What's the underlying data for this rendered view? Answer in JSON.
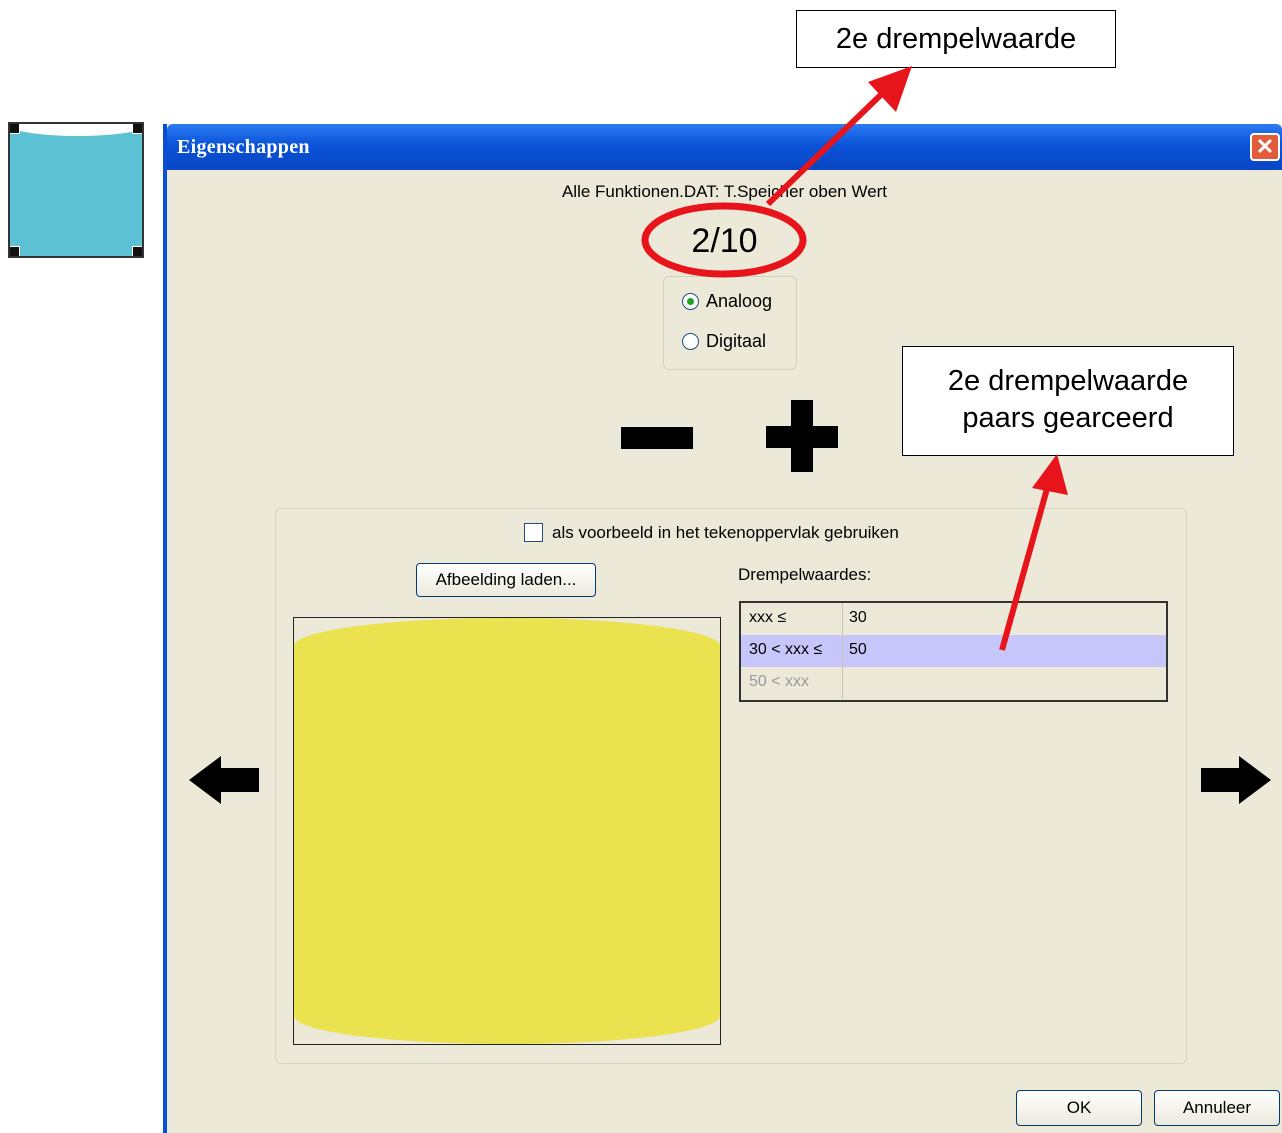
{
  "dialog": {
    "title": "Eigenschappen",
    "close_symbol": "✕",
    "subtitle": "Alle Funktionen.DAT: T.Speicher oben Wert",
    "counter": "2/10",
    "radio": {
      "analog_label": "Analoog",
      "digital_label": "Digitaal",
      "selected": "Analoog"
    },
    "checkbox_label": "als voorbeeld in het tekenoppervlak gebruiken",
    "checkbox_checked": false,
    "load_button": "Afbeelding laden...",
    "thresholds_label": "Drempelwaardes:",
    "thresholds": [
      {
        "condition": "xxx ≤",
        "value": "30"
      },
      {
        "condition": "30 < xxx ≤",
        "value": "50"
      },
      {
        "condition": "50 < xxx",
        "value": ""
      }
    ],
    "selected_threshold_row": 1,
    "ok_button": "OK",
    "cancel_button": "Annuleer",
    "preview_color": "#ebe24f",
    "thumbnail_color": "#5cc1d3",
    "highlight_color": "#c7c6fa"
  },
  "annotations": {
    "callout_top": "2e drempelwaarde",
    "callout_right_line1": "2e drempelwaarde",
    "callout_right_line2": "paars gearceerd",
    "annotation_color": "#e8141b"
  },
  "icons": [
    "close-icon",
    "minus-icon",
    "plus-icon",
    "arrow-left-icon",
    "arrow-right-icon"
  ]
}
